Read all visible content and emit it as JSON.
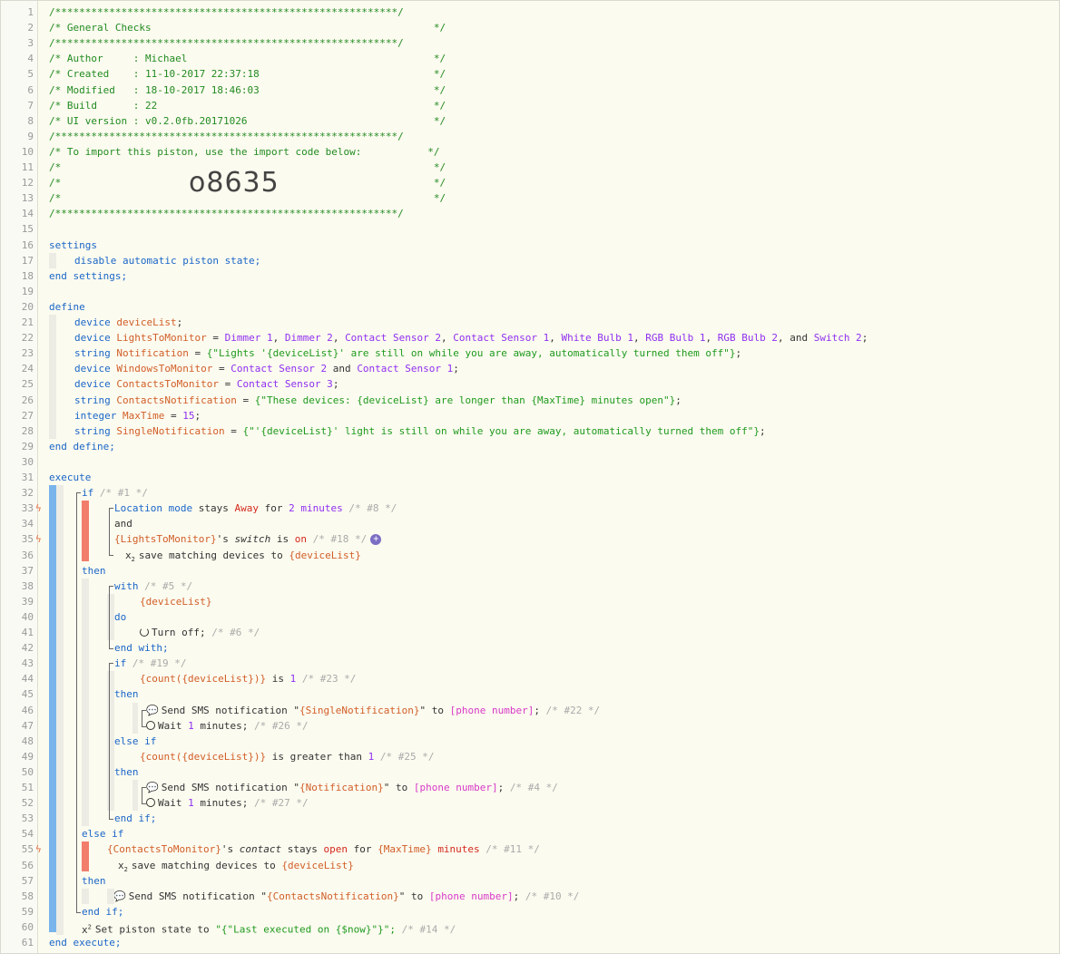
{
  "header": {
    "border": "/*********************************************************/",
    "title": "/* General Checks                                               */",
    "author": "/* Author     : Michael                                         */",
    "created": "/* Created    : 11-10-2017 22:37:18                             */",
    "modified": "/* Modified   : 18-10-2017 18:46:03                             */",
    "build": "/* Build      : 22                                              */",
    "ui_version": "/* UI version : v0.2.0fb.20171026                               */",
    "import_note": "/* To import this piston, use the import code below:           */",
    "empty": "/*                                                              */",
    "import_code": "o8635"
  },
  "lines": {
    "l16": "settings",
    "l17": "disable automatic piston state;",
    "l18": "end settings;",
    "l20": "define",
    "l31": "execute",
    "l61": "end execute;"
  },
  "define": {
    "l21_kw": "device",
    "l21_var": "deviceList",
    "l22_kw": "device",
    "l22_var": "LightsToMonitor",
    "l22_devs": [
      "Dimmer 1",
      "Dimmer 2",
      "Contact Sensor 2",
      "Contact Sensor 1",
      "White Bulb 1",
      "RGB Bulb 1",
      "RGB Bulb 2"
    ],
    "l22_last": "Switch 2",
    "l23_kw": "string",
    "l23_var": "Notification",
    "l23_str": "{\"Lights '{deviceList}' are still on while you are away, automatically turned them off\"}",
    "l24_kw": "device",
    "l24_var": "WindowsToMonitor",
    "l24_a": "Contact Sensor 2",
    "l24_b": "Contact Sensor 1",
    "l25_kw": "device",
    "l25_var": "ContactsToMonitor",
    "l25_a": "Contact Sensor 3",
    "l26_kw": "string",
    "l26_var": "ContactsNotification",
    "l26_str": "{\"These devices: {deviceList} are longer than {MaxTime} minutes open\"}",
    "l27_kw": "integer",
    "l27_var": "MaxTime",
    "l27_val": "15",
    "l28_kw": "string",
    "l28_var": "SingleNotification",
    "l28_str": "{\"'{deviceList}' light is still on while you are away, automatically turned them off\"}",
    "end": "end define;"
  },
  "exec": {
    "if1": "if",
    "if1_id": "/* #1 */",
    "c8_a": "Location mode",
    "c8_b": "stays",
    "c8_c": "Away",
    "c8_d": "for",
    "c8_e": "2 minutes",
    "c8_id": "/* #8 */",
    "and": "and",
    "c18_a": "{LightsToMonitor}",
    "c18_b": "'s",
    "c18_c": "switch",
    "c18_d": "is",
    "c18_e": "on",
    "c18_id": "/* #18 */",
    "save1": "save matching devices to",
    "save1_var": "{deviceList}",
    "then": "then",
    "with": "with",
    "with_id": "/* #5 */",
    "with_dev": "{deviceList}",
    "do": "do",
    "turnoff": "Turn off;",
    "turnoff_id": "/* #6 */",
    "endwith": "end with;",
    "if19": "if",
    "if19_id": "/* #19 */",
    "c23_expr": "{count({deviceList})}",
    "c23_is": "is",
    "c23_val": "1",
    "c23_id": "/* #23 */",
    "sms": "Send SMS notification",
    "sms22_var": "{SingleNotification}",
    "to": "to",
    "phone": "[phone number]",
    "sms22_id": "/* #22 */",
    "wait": "Wait",
    "wait_val": "1",
    "wait_unit": "minutes;",
    "wait26_id": "/* #26 */",
    "elseif": "else if",
    "c25_expr": "{count({deviceList})}",
    "c25_op": "is greater than",
    "c25_val": "1",
    "c25_id": "/* #25 */",
    "sms4_var": "{Notification}",
    "sms4_id": "/* #4 */",
    "wait27_id": "/* #27 */",
    "endif": "end if;",
    "c11_a": "{ContactsToMonitor}",
    "c11_b": "'s",
    "c11_c": "contact",
    "c11_d": "stays",
    "c11_e": "open",
    "c11_f": "for",
    "c11_g": "{MaxTime}",
    "c11_h": "minutes",
    "c11_id": "/* #11 */",
    "save2_var": "{deviceList}",
    "sms10_var": "{ContactsNotification}",
    "sms10_id": "/* #10 */",
    "setstate": "Set piston state to",
    "setstate_val": "\"{\"Last executed on {$now}\"}\";",
    "setstate_id": "/* #14 */"
  }
}
